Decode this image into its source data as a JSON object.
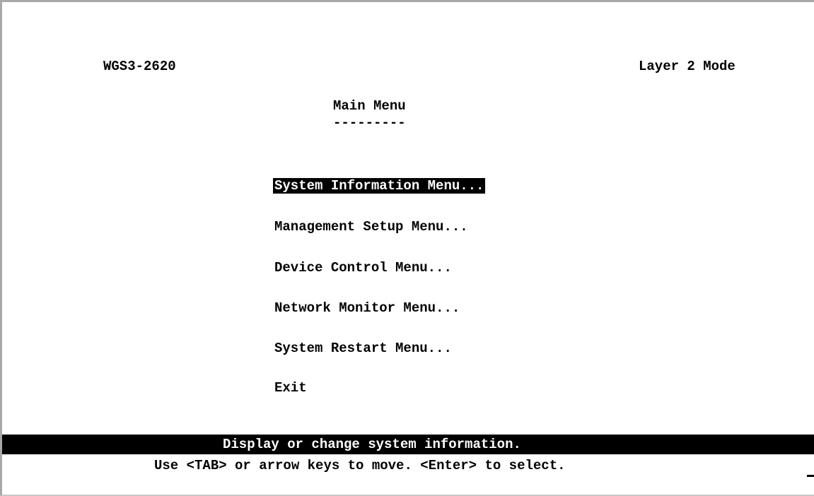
{
  "header": {
    "model": "WGS3-2620",
    "mode": "Layer 2 Mode"
  },
  "menu": {
    "title": "Main Menu",
    "underline": "---------",
    "items": [
      {
        "label": "System Information Menu...",
        "selected": true
      },
      {
        "label": "Management Setup Menu...",
        "selected": false
      },
      {
        "label": "Device Control Menu...",
        "selected": false
      },
      {
        "label": "Network Monitor Menu...",
        "selected": false
      },
      {
        "label": "System Restart Menu...",
        "selected": false
      },
      {
        "label": "Exit",
        "selected": false
      }
    ]
  },
  "status": {
    "description": "Display or change system information.",
    "help": "Use <TAB> or arrow keys to move. <Enter> to select."
  },
  "colors": {
    "background": "#ffffff",
    "text": "#000000",
    "highlight_bg": "#000000",
    "highlight_fg": "#ffffff"
  }
}
